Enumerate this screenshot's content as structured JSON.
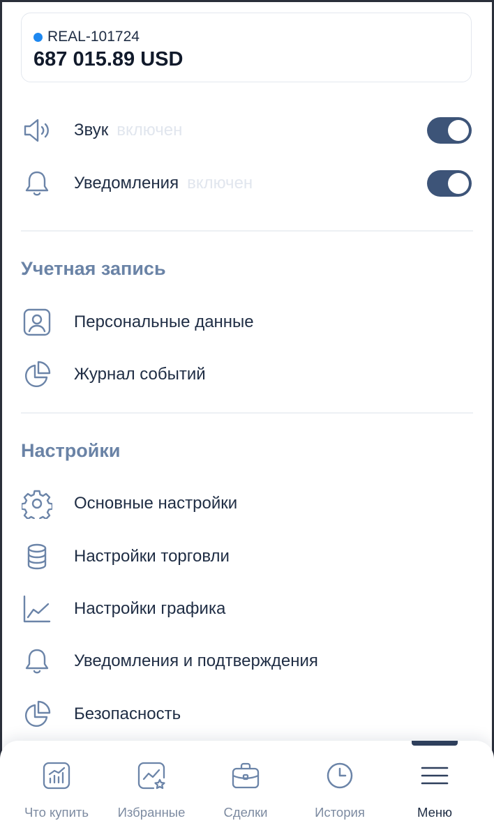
{
  "account": {
    "id": "REAL-101724",
    "balance": "687 015.89 USD",
    "status_color": "#1e88f0"
  },
  "toggles": [
    {
      "label": "Звук",
      "sub": "включен",
      "icon": "speaker-icon",
      "on": true
    },
    {
      "label": "Уведомления",
      "sub": "включен",
      "icon": "bell-icon",
      "on": true
    }
  ],
  "sections": {
    "account_title": "Учетная запись",
    "settings_title": "Настройки"
  },
  "account_items": [
    {
      "label": "Персональные данные",
      "icon": "user-profile-icon"
    },
    {
      "label": "Журнал событий",
      "icon": "pie-chart-icon"
    }
  ],
  "settings_items": [
    {
      "label": "Основные настройки",
      "icon": "gear-icon"
    },
    {
      "label": "Настройки торговли",
      "icon": "coin-stack-icon"
    },
    {
      "label": "Настройки графика",
      "icon": "line-chart-icon"
    },
    {
      "label": "Уведомления и подтверждения",
      "icon": "bell-icon"
    },
    {
      "label": "Безопасность",
      "icon": "pie-chart-icon"
    }
  ],
  "nav": [
    {
      "label": "Что купить",
      "icon": "bar-chart-icon",
      "active": false
    },
    {
      "label": "Избранные",
      "icon": "favorites-chart-icon",
      "active": false
    },
    {
      "label": "Сделки",
      "icon": "briefcase-icon",
      "active": false
    },
    {
      "label": "История",
      "icon": "clock-icon",
      "active": false
    },
    {
      "label": "Меню",
      "icon": "menu-icon",
      "active": true
    }
  ],
  "colors": {
    "toggle_on": "#3d5478",
    "section_title": "#6a83a6",
    "icon_stroke": "#6b84a8",
    "nav_inactive": "#7d8ba1"
  }
}
